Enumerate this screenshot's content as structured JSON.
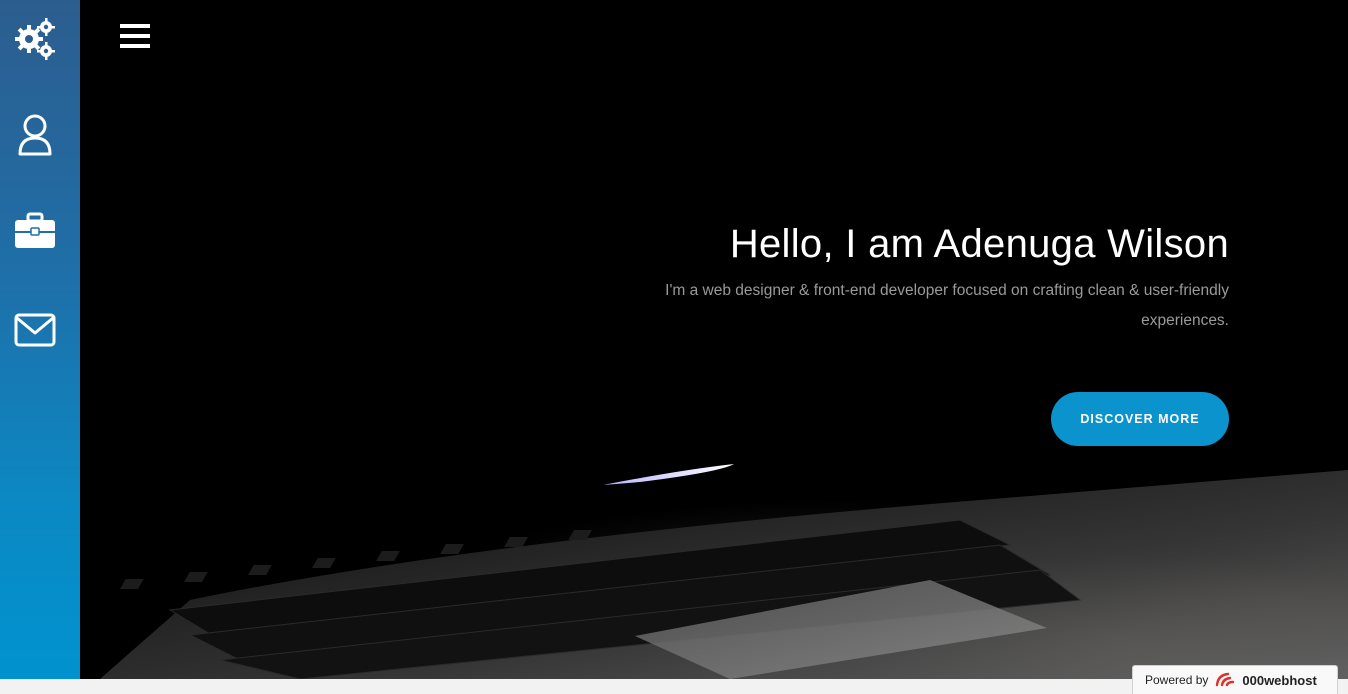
{
  "sidebar": {
    "items": [
      {
        "icon": "gears-icon",
        "name": "sidebar-item-settings"
      },
      {
        "icon": "user-icon",
        "name": "sidebar-item-about"
      },
      {
        "icon": "briefcase-icon",
        "name": "sidebar-item-portfolio"
      },
      {
        "icon": "envelope-icon",
        "name": "sidebar-item-contact"
      }
    ]
  },
  "header": {
    "menu_icon": "hamburger-menu-icon"
  },
  "hero": {
    "title": "Hello, I am Adenuga Wilson",
    "subtitle": "I'm a web designer & front-end developer focused on crafting clean & user-friendly experiences.",
    "cta_label": "DISCOVER MORE"
  },
  "badge": {
    "powered_by": "Powered by",
    "brand": "000webhost"
  },
  "colors": {
    "accent": "#0a93cc",
    "sidebar_top": "#2c5d8f",
    "sidebar_bottom": "#0093cf",
    "hero_bg": "#000000",
    "subtitle_text": "#9a9a9a"
  }
}
